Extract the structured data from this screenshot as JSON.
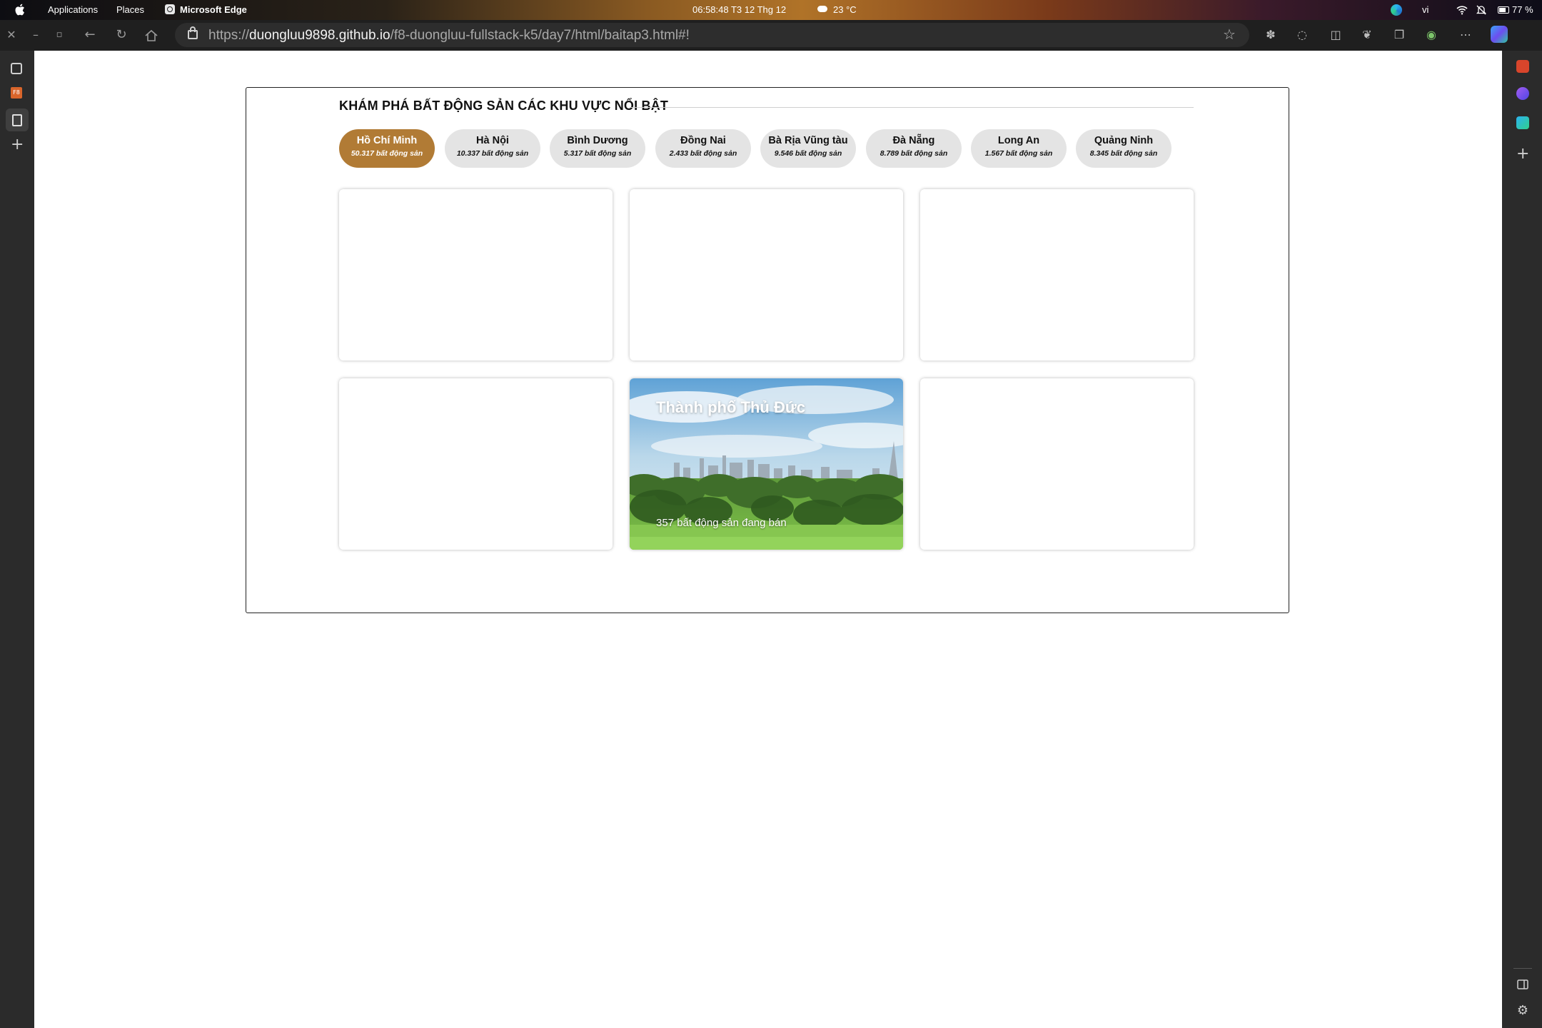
{
  "os_bar": {
    "menus": [
      "Applications",
      "Places"
    ],
    "active_app": "Microsoft Edge",
    "clock": "06:58:48  T3 12 Thg 12",
    "weather": "23 °C",
    "language": "vi",
    "battery": "77 %"
  },
  "browser": {
    "url_prefix": "https://",
    "url_domain": "duongluu9898.github.io",
    "url_path": "/f8-duongluu-fullstack-k5/day7/html/baitap3.html#!"
  },
  "rail": {
    "f8_label": "F8"
  },
  "page": {
    "section_title": "KHÁM PHÁ BẤT ĐỘNG SẢN CÁC KHU VỰC NỔI BẬT",
    "tabs": [
      {
        "name": "Hồ Chí Minh",
        "count": "50.317 bất động sản",
        "active": true
      },
      {
        "name": "Hà Nội",
        "count": "10.337 bất động sản",
        "active": false
      },
      {
        "name": "Bình Dương",
        "count": "5.317 bất động sản",
        "active": false
      },
      {
        "name": "Đồng Nai",
        "count": "2.433 bất động sản",
        "active": false
      },
      {
        "name": "Bà Rịa Vũng tàu",
        "count": "9.546 bất động sản",
        "active": false
      },
      {
        "name": "Đà Nẵng",
        "count": "8.789 bất động sản",
        "active": false
      },
      {
        "name": "Long An",
        "count": "1.567 bất động sản",
        "active": false
      },
      {
        "name": "Quảng Ninh",
        "count": "8.345 bất động sản",
        "active": false
      }
    ],
    "featured_card": {
      "title": "Thành phố Thủ Đức",
      "subtitle": "357 bất động sản đang bán"
    },
    "accent_color": "#b17b35",
    "tab_bg_color": "#e4e4e4"
  }
}
